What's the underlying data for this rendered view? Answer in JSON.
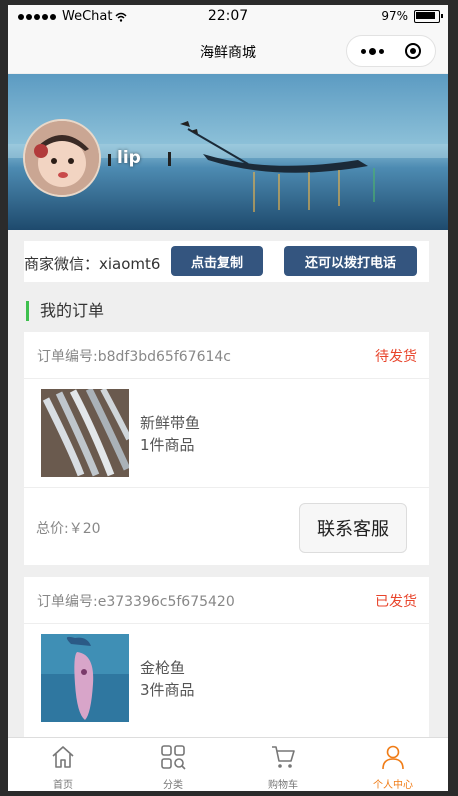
{
  "status_bar": {
    "carrier": "WeChat",
    "time": "22:07",
    "battery": "97%"
  },
  "navbar": {
    "title": "海鲜商城"
  },
  "profile": {
    "username": "lip"
  },
  "contact": {
    "label": "商家微信：xiaomt6",
    "copy_button": "点击复制",
    "call_button": "还可以拨打电话"
  },
  "section": {
    "title": "我的订单"
  },
  "orders": [
    {
      "order_no": "订单编号:b8df3bd65f67614c",
      "status": "待发货",
      "product_name": "新鲜带鱼",
      "item_count": "1件商品",
      "total": "总价:￥20",
      "service_button": "联系客服"
    },
    {
      "order_no": "订单编号:e373396c5f675420",
      "status": "已发货",
      "product_name": "金枪鱼",
      "item_count": "3件商品"
    }
  ],
  "tabbar": [
    {
      "label": "首页"
    },
    {
      "label": "分类"
    },
    {
      "label": "购物车"
    },
    {
      "label": "个人中心"
    }
  ],
  "colors": {
    "accent_status": "#e8452c",
    "button_dark": "#34557f",
    "section_bar": "#3ec04e",
    "tab_active": "#f07c16"
  }
}
